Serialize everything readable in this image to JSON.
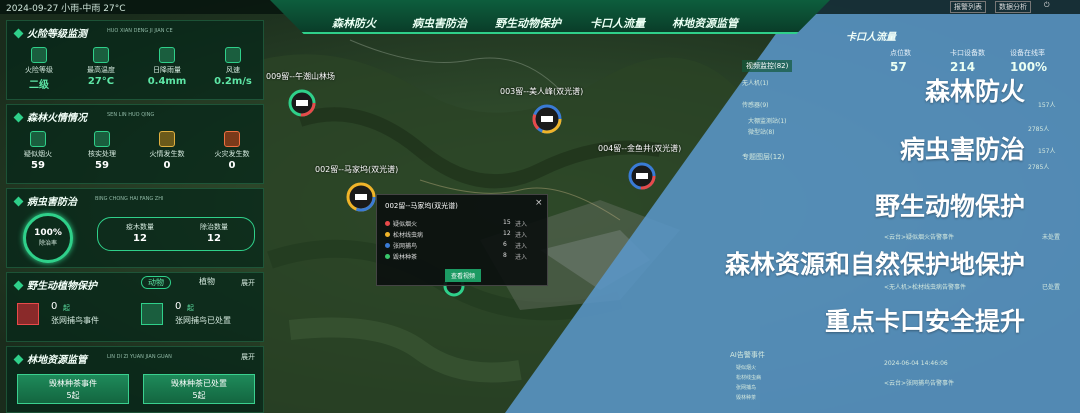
{
  "header": {
    "datetime": "2024-09-27 小雨-中雨 27°C",
    "nav": [
      "森林防火",
      "病虫害防治",
      "野生动物保护",
      "卡口人流量",
      "林地资源监管"
    ],
    "top_buttons": [
      "报警列表",
      "数据分析"
    ]
  },
  "fire_level": {
    "title": "火险等级监测",
    "subtitle": "HUO XIAN DENG JI JIAN CE",
    "items": [
      {
        "label": "火险等级",
        "value": "二级",
        "icon": "fire-icon"
      },
      {
        "label": "最高温度",
        "value": "27°C",
        "icon": "thermometer-icon"
      },
      {
        "label": "日降雨量",
        "value": "0.4mm",
        "icon": "rain-icon"
      },
      {
        "label": "风速",
        "value": "0.2m/s",
        "icon": "wind-icon"
      }
    ]
  },
  "forest_fire": {
    "title": "森林火情情况",
    "subtitle": "SEN LIN HUO QING",
    "items": [
      {
        "label": "疑似烟火",
        "value": "59",
        "icon": "smoke-icon"
      },
      {
        "label": "核实处理",
        "value": "59",
        "icon": "check-icon"
      },
      {
        "label": "火情发生数",
        "value": "0",
        "icon": "flame-icon"
      },
      {
        "label": "火灾发生数",
        "value": "0",
        "icon": "fire-tree-icon"
      }
    ]
  },
  "pest": {
    "title": "病虫害防治",
    "subtitle": "BING CHONG HAI FANG ZHI",
    "rate": "100%",
    "rate_label": "除治率",
    "items": [
      {
        "label": "疫木数量",
        "value": "12"
      },
      {
        "label": "除治数量",
        "value": "12"
      }
    ]
  },
  "wildlife": {
    "title": "野生动植物保护",
    "tabs": [
      "动物",
      "植物"
    ],
    "expand": "展开",
    "items": [
      {
        "count": "0",
        "unit": "起",
        "label": "张网捕鸟事件"
      },
      {
        "count": "0",
        "unit": "起",
        "label": "张网捕鸟已处置"
      }
    ]
  },
  "forest_land": {
    "title": "林地资源监管",
    "subtitle": "LIN DI ZI YUAN JIAN GUAN",
    "expand": "展开",
    "buttons": [
      {
        "label": "毁林种茶事件",
        "value": "5起"
      },
      {
        "label": "毁林种茶已处置",
        "value": "5起"
      }
    ]
  },
  "map": {
    "markers": [
      {
        "label": "009留--午潮山林场"
      },
      {
        "label": "003留--美人峰(双光谱)"
      },
      {
        "label": "004留--金鱼井(双光谱)"
      },
      {
        "label": "002留--马家坞(双光谱)"
      }
    ],
    "popup": {
      "title": "002留--马家坞(双光谱)",
      "rows": [
        {
          "label": "疑似烟火",
          "count": "15",
          "action": "进入",
          "color": "#e84a4a"
        },
        {
          "label": "松材线虫病",
          "count": "12",
          "action": "进入",
          "color": "#f0b429"
        },
        {
          "label": "张网捕鸟",
          "count": "6",
          "action": "进入",
          "color": "#3a7bd5"
        },
        {
          "label": "毁林种茶",
          "count": "8",
          "action": "进入",
          "color": "#39c66b"
        }
      ],
      "button": "查看视频"
    }
  },
  "right_panel": {
    "title": "卡口人流量",
    "stats": [
      {
        "label": "点位数",
        "value": "57"
      },
      {
        "label": "卡口设备数",
        "value": "214"
      },
      {
        "label": "设备在线率",
        "value": "100%"
      }
    ],
    "layers": [
      {
        "label": "视频监控(82)"
      },
      {
        "label": "无人机(1)"
      },
      {
        "label": "传感器(9)"
      },
      {
        "label": "大棚监测站(1)"
      },
      {
        "label": "微型站(8)"
      },
      {
        "label": "专题图层(12)"
      }
    ],
    "numbers": [
      "157人",
      "2785人",
      "157人",
      "2785人"
    ],
    "events": [
      {
        "tag": "未处置",
        "text": "<云台>疑似烟火告警事件"
      },
      {
        "tag": "已处置",
        "text": "<无人机>松材线虫病告警事件"
      },
      {
        "tag": "",
        "text": "2024-06-04 14:46:06"
      },
      {
        "tag": "",
        "text": "<云台>张网捕鸟告警事件"
      }
    ],
    "ai_title": "AI告警事件",
    "ai_legend": [
      "疑似烟火",
      "松材线虫病",
      "张网捕鸟",
      "毁林种茶"
    ]
  },
  "overlay": {
    "lines": [
      "森林防火",
      "病虫害防治",
      "野生动物保护",
      "森林资源和自然保护地保护",
      "重点卡口安全提升"
    ]
  },
  "colors": {
    "accent": "#2fd08a",
    "overlay": "#5a96c8",
    "navbar": "#0d5e3d"
  }
}
